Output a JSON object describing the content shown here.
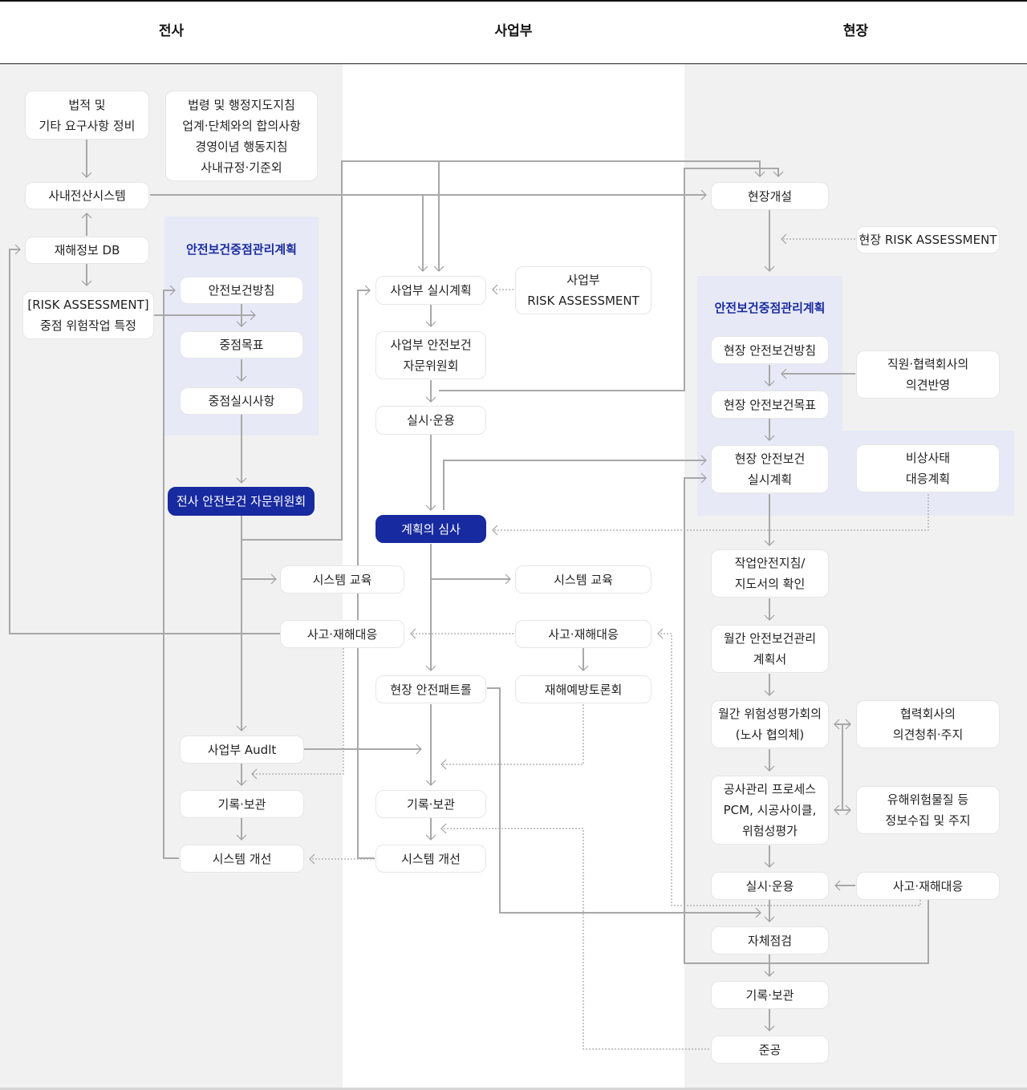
{
  "columns": [
    "전사",
    "사업부",
    "현장"
  ],
  "panels": {
    "corporate_plan_title": "안전보건중점관리계획",
    "site_plan_title": "안전보건중점관리계획"
  },
  "corporate": {
    "legal_requirements": "법적 및\n기타 요구사항 정비",
    "regulations": "법령 및 행정지도지침\n업계·단체와의 합의사항\n경영이념 행동지침\n사내규정·기준외",
    "internal_system": "사내전산시스템",
    "accident_db": "재해정보 DB",
    "risk_assessment": "[RISK ASSESSMENT]\n중점 위험작업 특정",
    "safety_policy": "안전보건방침",
    "key_goals": "중점목표",
    "key_actions": "중점실시사항",
    "committee": "전사 안전보건 자문위원회",
    "business_audit": "사업부 Audlt",
    "records": "기록·보관",
    "system_improvement": "시스템 개선"
  },
  "division": {
    "action_plan": "사업부 실시계획",
    "risk_assessment": "사업부\nRISK ASSESSMENT",
    "committee": "사업부 안전보건\n자문위원회",
    "operation": "실시·운용",
    "plan_review": "계획의 심사",
    "system_training_left": "시스템 교육",
    "system_training_right": "시스템 교육",
    "accident_response_left": "사고·재해대응",
    "accident_response_right": "사고·재해대응",
    "site_patrol": "현장 안전패트롤",
    "prevention_forum": "재해예방토론회",
    "records": "기록·보관",
    "system_improvement": "시스템 개선"
  },
  "site": {
    "site_opening": "현장개설",
    "risk_assessment": "현장 RISK ASSESSMENT",
    "safety_policy": "현장 안전보건방침",
    "opinions": "직원·협력회사의\n의견반영",
    "safety_goals": "현장 안전보건목표",
    "action_plan": "현장 안전보건\n실시계획",
    "emergency_plan": "비상사태\n대응계획",
    "work_guidelines": "작업안전지침/\n지도서의 확인",
    "monthly_plan": "월간 안전보건관리\n계획서",
    "monthly_risk_meeting": "월간 위험성평가회의\n(노사 협의체)",
    "partner_opinions": "협력회사의\n의견청취·주지",
    "construction_process": "공사관리 프로세스\nPCM, 시공사이클,\n위험성평가",
    "hazard_info": "유해위험물질 등\n정보수집 및 주지",
    "operation": "실시·운용",
    "accident_response": "사고·재해대응",
    "self_inspection": "자체점검",
    "records": "기록·보관",
    "completion": "준공"
  },
  "colors": {
    "accent": "#182a9f",
    "panel": "#e7e9f7",
    "lane_gray": "#f1f1f1",
    "connector": "#a8a8a8"
  }
}
